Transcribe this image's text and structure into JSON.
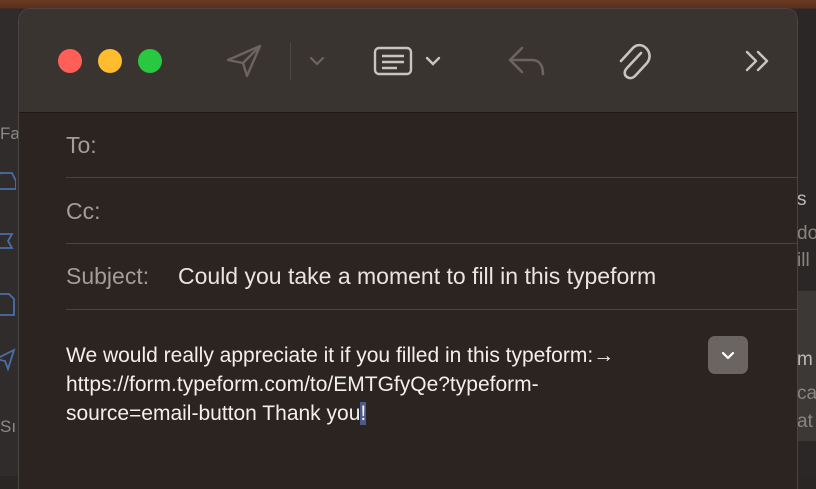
{
  "background": {
    "left_glyphs": [
      "Fa",
      "Sı"
    ],
    "right_fragments": [
      "s",
      "do",
      "ill",
      "m",
      "ca",
      "at"
    ]
  },
  "toolbar": {
    "send_icon": "send-paper-plane-icon",
    "send_options_icon": "chevron-down-icon",
    "header_fields_icon": "header-fields-list-icon",
    "reply_icon": "reply-arrow-icon",
    "attach_icon": "paperclip-icon",
    "more_icon": "double-chevron-right-icon"
  },
  "compose": {
    "to_label": "To:",
    "to_value": "",
    "cc_label": "Cc:",
    "cc_value": "",
    "subject_label": "Subject:",
    "subject_value": "Could you take a moment to fill in this typeform"
  },
  "message": {
    "line1": "We would really appreciate it if you filled in this typeform:→",
    "line2": "https://form.typeform.com/to/EMTGfyQe?typeform-",
    "line3_start": "source=email-button Thank you",
    "line3_selected": "!"
  },
  "colors": {
    "close": "#ff5f57",
    "minimize": "#febc2e",
    "zoom": "#28c840",
    "window_bg": "#2b2421",
    "toolbar_bg": "#3a3431"
  }
}
